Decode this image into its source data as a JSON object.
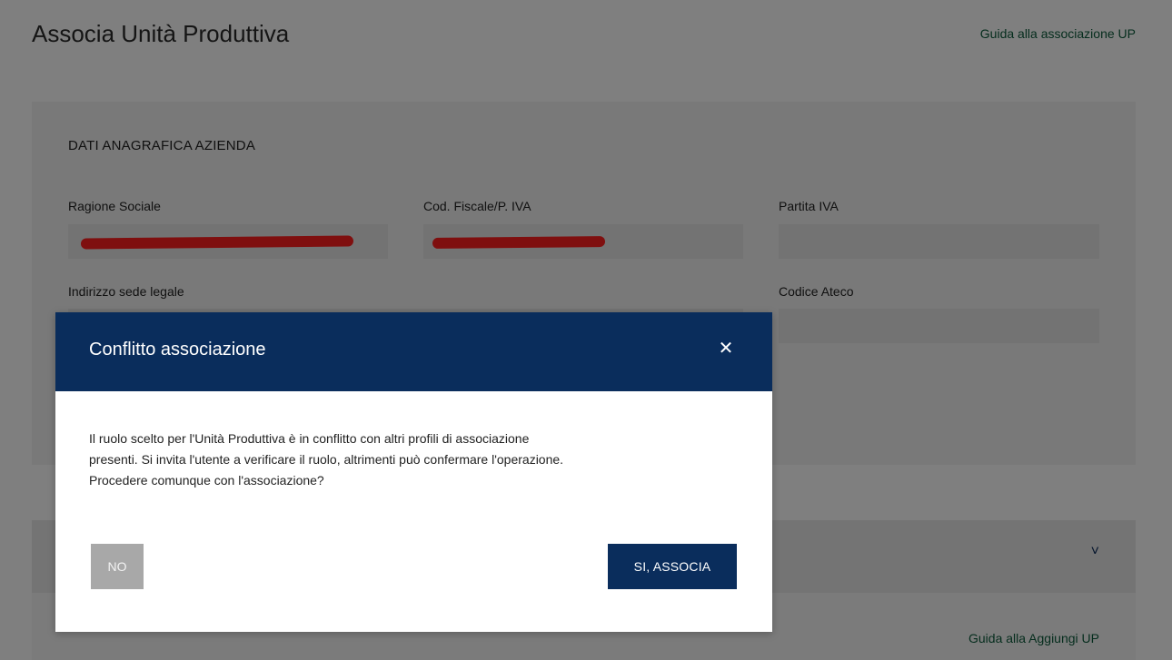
{
  "page": {
    "title": "Associa Unità Produttiva",
    "guide_link": "Guida alla associazione UP"
  },
  "company": {
    "section_title": "DATI ANAGRAFICA AZIENDA",
    "fields": {
      "ragione_sociale": {
        "label": "Ragione Sociale",
        "value": ""
      },
      "cod_fiscale": {
        "label": "Cod. Fiscale/P. IVA",
        "value": ""
      },
      "partita_iva": {
        "label": "Partita IVA",
        "value": ""
      },
      "indirizzo": {
        "label": "Indirizzo sede legale",
        "value": ""
      },
      "codice_ateco": {
        "label": "Codice Ateco",
        "value": ""
      }
    }
  },
  "section2": {
    "chevron": "˅"
  },
  "section3": {
    "guide_link": "Guida alla Aggiungi UP"
  },
  "modal": {
    "title": "Conflitto associazione",
    "close_symbol": "✕",
    "body_lines": [
      "Il ruolo scelto per l'Unità Produttiva è in conflitto con altri profili di associazione",
      "presenti. Si invita l'utente a verificare il ruolo, altrimenti può confermare l'operazione.",
      "Procedere comunque con l'associazione?"
    ],
    "no_label": "NO",
    "yes_label": "SI, ASSOCIA"
  },
  "colors": {
    "modal_header": "#0a2d5c",
    "primary_button": "#0a2d5c",
    "secondary_button": "#a8a8a8",
    "redaction": "#ff1e1e"
  }
}
